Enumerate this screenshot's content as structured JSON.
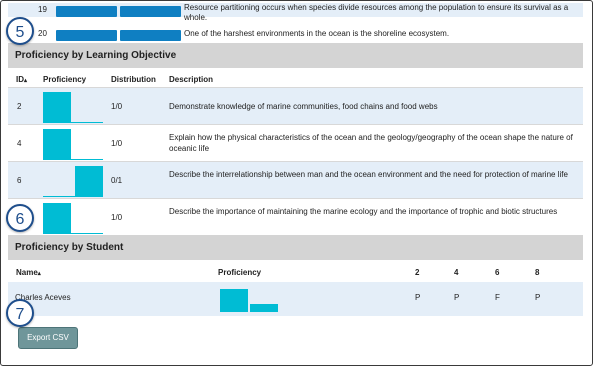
{
  "top_rows": [
    {
      "id": "19",
      "text": "Resource partitioning occurs when species divide resources among the population to ensure its survival as a whole."
    },
    {
      "id": "20",
      "text": "One of the harshest environments in the ocean is the shoreline ecosystem."
    }
  ],
  "badges": {
    "five": "5",
    "six": "6",
    "seven": "7"
  },
  "objectives": {
    "title": "Proficiency by Learning Objective",
    "columns": {
      "id": "ID",
      "sort_icon": "▴",
      "proficiency": "Proficiency",
      "distribution": "Distribution",
      "description": "Description"
    },
    "rows": [
      {
        "id": "2",
        "distribution": "1/0",
        "description": "Demonstrate knowledge of marine communities, food chains and food webs",
        "proficient": 1,
        "not_proficient": 0
      },
      {
        "id": "4",
        "distribution": "1/0",
        "description": "Explain how the physical characteristics of the ocean and the geology/geography of the ocean shape the nature of oceanic life",
        "proficient": 1,
        "not_proficient": 0
      },
      {
        "id": "6",
        "distribution": "0/1",
        "description": "Describe the interrelationship between man and the ocean environment and the need for protection of marine life",
        "proficient": 0,
        "not_proficient": 1
      },
      {
        "id": "8",
        "distribution": "1/0",
        "description": "Describe the importance of maintaining the marine ecology and the importance of trophic and biotic structures",
        "proficient": 1,
        "not_proficient": 0
      }
    ]
  },
  "students": {
    "title": "Proficiency by Student",
    "columns": {
      "name": "Name",
      "sort_icon": "▴",
      "proficiency": "Proficiency",
      "obj_ids": [
        "2",
        "4",
        "6",
        "8"
      ]
    },
    "rows": [
      {
        "name": "Charles Aceves",
        "scores": [
          "P",
          "P",
          "F",
          "P"
        ],
        "proficient": 3,
        "not_proficient": 1
      }
    ]
  },
  "export_label": "Export CSV",
  "colors": {
    "accent": "#00bcd4",
    "bar_blue": "#0f7fc2",
    "badge": "#1e4e8c",
    "button": "#6f969a"
  }
}
